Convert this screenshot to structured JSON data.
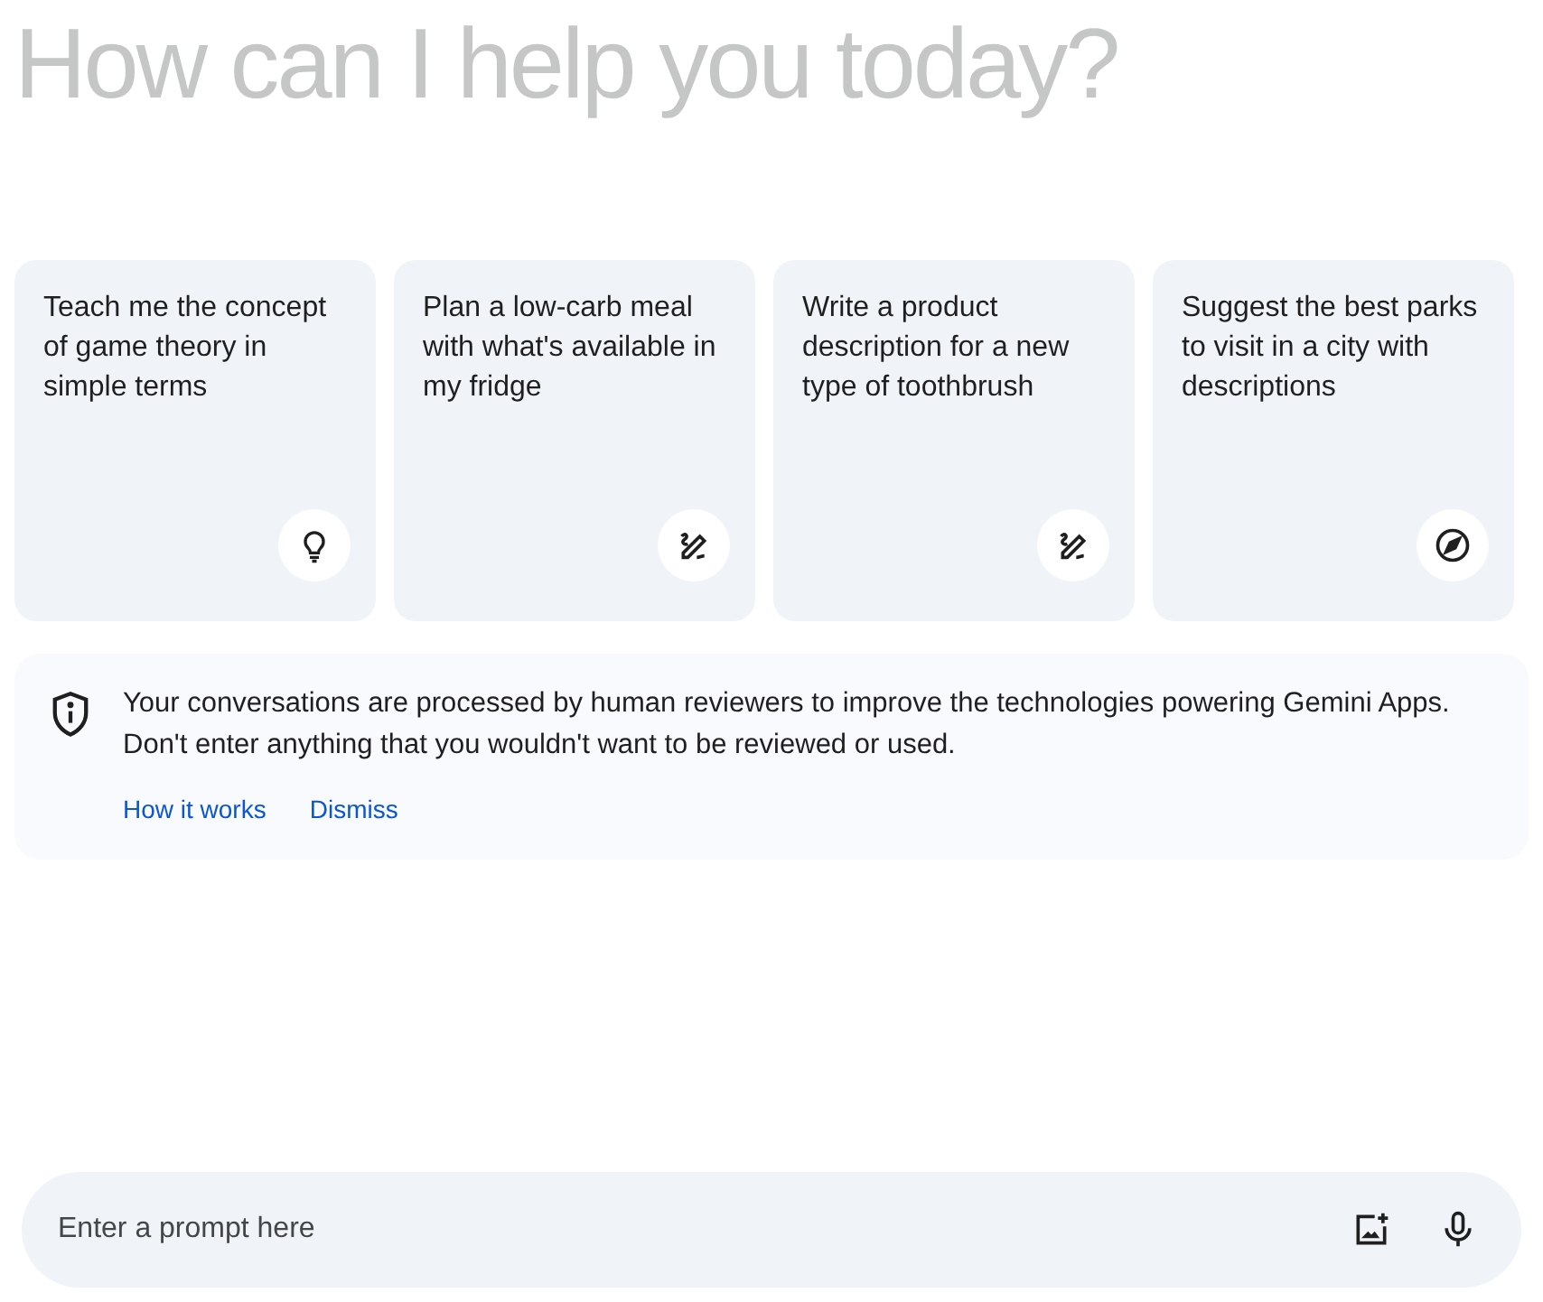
{
  "heading": "How can I help you today?",
  "suggestions": [
    {
      "text": "Teach me the concept of game theory in simple terms",
      "kind": "bulb"
    },
    {
      "text": "Plan a low-carb meal with what's available in my fridge",
      "kind": "pen"
    },
    {
      "text": "Write a product description for a new type of toothbrush",
      "kind": "pen"
    },
    {
      "text": "Suggest the best parks to visit in a city with descriptions",
      "kind": "compass"
    }
  ],
  "notice": {
    "text": "Your conversations are processed by human reviewers to improve the technologies powering Gemini Apps. Don't enter anything that you wouldn't want to be reviewed or used.",
    "links": [
      "How it works",
      "Dismiss"
    ]
  },
  "prompt": {
    "placeholder": "Enter a prompt here"
  }
}
